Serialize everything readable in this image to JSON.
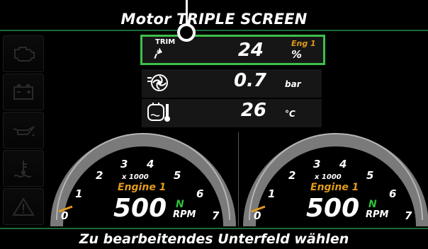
{
  "header": {
    "title": "Motor TRIPLE SCREEN"
  },
  "sidebar": {
    "items": [
      {
        "icon": "check-engine-icon"
      },
      {
        "icon": "battery-icon"
      },
      {
        "icon": "oil-can-icon"
      },
      {
        "icon": "coolant-temperature-icon"
      },
      {
        "icon": "warning-triangle-icon"
      }
    ]
  },
  "fields": [
    {
      "icon": "trim-icon",
      "icon_label": "TRIM",
      "value": "24",
      "unit": "%",
      "engine": "Eng 1",
      "selected": true
    },
    {
      "icon": "turbo-boost-icon",
      "value": "0.7",
      "unit": "bar"
    },
    {
      "icon": "engine-temperature-icon",
      "value": "26",
      "unit": "°C"
    }
  ],
  "gauges": [
    {
      "engine": "Engine 1",
      "multiplier": "x 1000",
      "value": "500",
      "gear": "N",
      "unit": "RPM",
      "ticks": [
        "0",
        "1",
        "2",
        "3",
        "4",
        "5",
        "6",
        "7"
      ],
      "rpm_x1000": 0.5
    },
    {
      "engine": "Engine 1",
      "multiplier": "x 1000",
      "value": "500",
      "gear": "N",
      "unit": "RPM",
      "ticks": [
        "0",
        "1",
        "2",
        "3",
        "4",
        "5",
        "6",
        "7"
      ],
      "rpm_x1000": 0.5
    }
  ],
  "footer": {
    "text": "Zu bearbeitendes Unterfeld wählen"
  },
  "colors": {
    "accent": "#3fbf4a",
    "engine": "#e39b1a",
    "neutral_gear": "#2fbf3a",
    "divider": "#1e6a3a"
  }
}
